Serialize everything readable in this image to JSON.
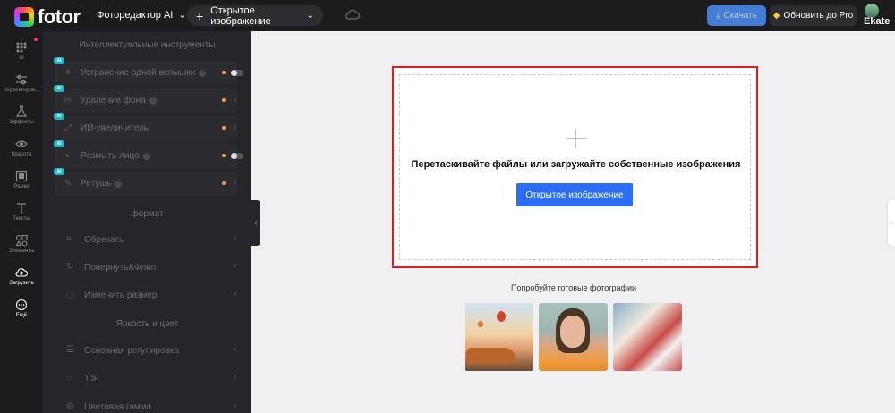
{
  "header": {
    "logo_text": "fotor",
    "editor_mode": "Фоторедактор AI",
    "open_image": "Открытое изображение",
    "download": "Скачать",
    "upgrade": "Обновить до Pro",
    "user_name": "Ekat⁠e"
  },
  "rail": [
    {
      "label": "AI",
      "icon": "ai-grid-icon"
    },
    {
      "label": "Корректиров...",
      "icon": "sliders-icon"
    },
    {
      "label": "Эффекты",
      "icon": "flask-icon"
    },
    {
      "label": "Красота",
      "icon": "eye-icon"
    },
    {
      "label": "Рамки",
      "icon": "frame-icon"
    },
    {
      "label": "Тексты",
      "icon": "text-icon"
    },
    {
      "label": "Элементы",
      "icon": "shapes-icon"
    },
    {
      "label": "Загрузить",
      "icon": "cloud-upload-icon"
    },
    {
      "label": "Ещё",
      "icon": "more-icon"
    }
  ],
  "panel": {
    "section_ai": "Интеллектуальные инструменты",
    "ai_tools": [
      {
        "label": "Устранение одной вспышки",
        "badge": "AI",
        "control": "toggle"
      },
      {
        "label": "Удаление фона",
        "badge": "AI",
        "control": "chevron"
      },
      {
        "label": "ИИ-увеличитель",
        "badge": "AI",
        "control": "chevron"
      },
      {
        "label": "Размыть лицо",
        "badge": "AI",
        "control": "toggle"
      },
      {
        "label": "Ретушь",
        "badge": "AI",
        "control": "chevron"
      }
    ],
    "section_format": "формат",
    "format_tools": [
      "Обрезать",
      "Повернуть&Флип",
      "Изменить размер"
    ],
    "section_light": "Яркость и цвет",
    "light_tools": [
      "Основная регулировка",
      "Тон",
      "Цветовая гамма"
    ]
  },
  "canvas": {
    "drop_text": "Перетаскивайте файлы или загружайте собственные изображения",
    "drop_button": "Открытое изображение",
    "try_text": "Попробуйте готовые фотографии"
  },
  "colors": {
    "accent": "#2a6ef5",
    "highlight_border": "#e21c1c",
    "ai_badge": "#26b3c4",
    "dot": "#ff9a3c"
  }
}
